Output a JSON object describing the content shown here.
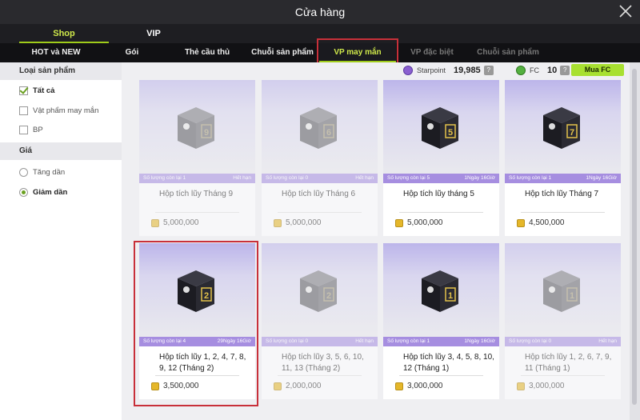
{
  "window": {
    "title": "Cửa hàng"
  },
  "top_tabs": [
    {
      "label": "Shop",
      "active": true
    },
    {
      "label": "VIP",
      "active": false
    }
  ],
  "sub_tabs": [
    {
      "label": "HOT và NEW",
      "state": "normal"
    },
    {
      "label": "Gói",
      "state": "normal"
    },
    {
      "label": "Thẻ cầu thủ",
      "state": "normal"
    },
    {
      "label": "Chuỗi sản phẩm",
      "state": "normal"
    },
    {
      "label": "VP may mắn",
      "state": "active"
    },
    {
      "label": "VP đặc biệt",
      "state": "dim"
    },
    {
      "label": "Chuỗi sản phẩm",
      "state": "dim"
    }
  ],
  "sidebar": {
    "category_header": "Loại sản phẩm",
    "categories": [
      {
        "label": "Tất cả",
        "checked": true
      },
      {
        "label": "Vật phẩm may mắn",
        "checked": false
      },
      {
        "label": "BP",
        "checked": false
      }
    ],
    "price_header": "Giá",
    "sort_options": [
      {
        "label": "Tăng dần",
        "selected": false
      },
      {
        "label": "Giảm dần",
        "selected": true
      }
    ]
  },
  "currency": {
    "starpoint_label": "Starpoint",
    "starpoint_value": "19,985",
    "fc_label": "FC",
    "fc_value": "10",
    "help": "?",
    "buy_fc_label": "Mua FC"
  },
  "products": [
    {
      "name": "Hộp tích lũy Tháng 9",
      "remaining": "Số lượng còn lại 1",
      "time": "Hết hạn",
      "price": "5,000,000",
      "available": false,
      "label_digit": "9"
    },
    {
      "name": "Hộp tích lũy Tháng 6",
      "remaining": "Số lượng còn lại 0",
      "time": "Hết hạn",
      "price": "5,000,000",
      "available": false,
      "label_digit": "6"
    },
    {
      "name": "Hộp tích lũy tháng 5",
      "remaining": "Số lượng còn lại 5",
      "time": "1Ngày 16Giờ",
      "price": "5,000,000",
      "available": true,
      "label_digit": "5"
    },
    {
      "name": "Hộp tích lũy Tháng 7",
      "remaining": "Số lượng còn lại 1",
      "time": "1Ngày 16Giờ",
      "price": "4,500,000",
      "available": true,
      "label_digit": "7"
    },
    {
      "name": "Hộp tích lũy 1, 2, 4, 7, 8, 9, 12 (Tháng 2)",
      "remaining": "Số lượng còn lại 4",
      "time": "29Ngày 16Giờ",
      "price": "3,500,000",
      "available": true,
      "label_digit": "2"
    },
    {
      "name": "Hộp tích lũy 3, 5, 6, 10, 11, 13 (Tháng 2)",
      "remaining": "Số lượng còn lại 0",
      "time": "Hết hạn",
      "price": "2,000,000",
      "available": false,
      "label_digit": "2"
    },
    {
      "name": "Hộp tích lũy 3, 4, 5, 8, 10, 12 (Tháng 1)",
      "remaining": "Số lượng còn lại 1",
      "time": "1Ngày 16Giờ",
      "price": "3,000,000",
      "available": true,
      "label_digit": "1"
    },
    {
      "name": "Hộp tích lũy 1, 2, 6, 7, 9, 11 (Tháng 1)",
      "remaining": "Số lượng còn lại 0",
      "time": "Hết hạn",
      "price": "3,000,000",
      "available": false,
      "label_digit": "1"
    }
  ],
  "colors": {
    "accent": "#9fcc1a",
    "highlight": "#c8303a",
    "info_bar": "#a68ee0",
    "buy_button": "#a8e030"
  },
  "icons": {
    "close": "close-icon",
    "starpoint": "starpoint-coin-icon",
    "fc": "fc-coin-icon",
    "price": "gold-coin-icon",
    "box": "mystery-box-icon"
  }
}
